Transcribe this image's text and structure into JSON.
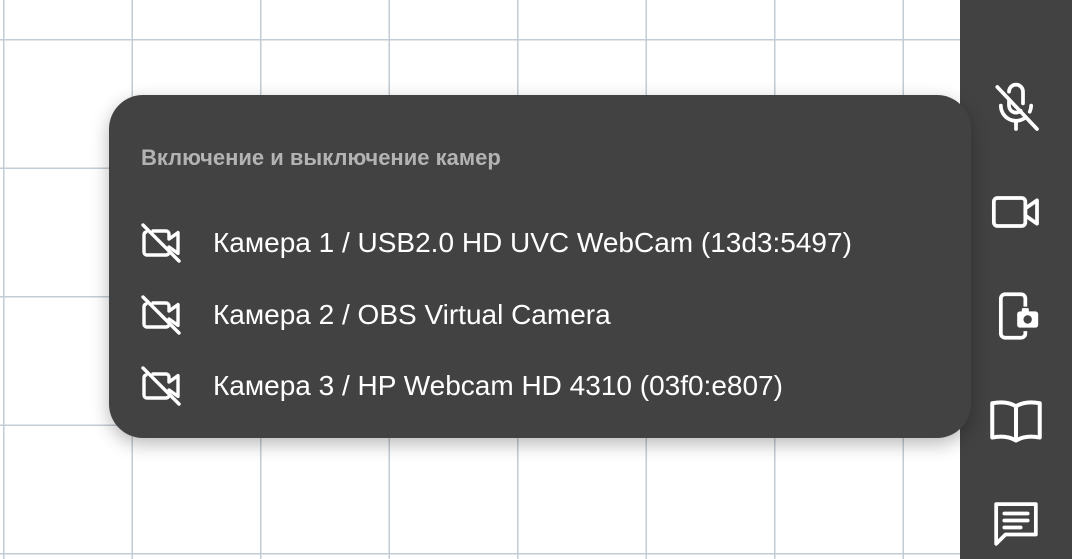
{
  "popup": {
    "title": "Включение и выключение камер",
    "cameras": [
      {
        "label": "Камера 1 / USB2.0 HD UVC WebCam (13d3:5497)",
        "icon": "videocam-off-icon",
        "enabled": false
      },
      {
        "label": "Камера 2 / OBS Virtual Camera",
        "icon": "videocam-off-icon",
        "enabled": false
      },
      {
        "label": "Камера 3 / HP Webcam HD 4310 (03f0:e807)",
        "icon": "videocam-off-icon",
        "enabled": false
      }
    ]
  },
  "toolbar": {
    "items": [
      {
        "icon": "mic-off-icon"
      },
      {
        "icon": "videocam-icon"
      },
      {
        "icon": "phone-camera-icon"
      },
      {
        "icon": "book-icon"
      },
      {
        "icon": "chat-icon"
      }
    ]
  },
  "colors": {
    "panel": "#424242",
    "grid_line": "#c3ccd4",
    "text": "#ffffff",
    "title_text": "#b3b3b3"
  }
}
